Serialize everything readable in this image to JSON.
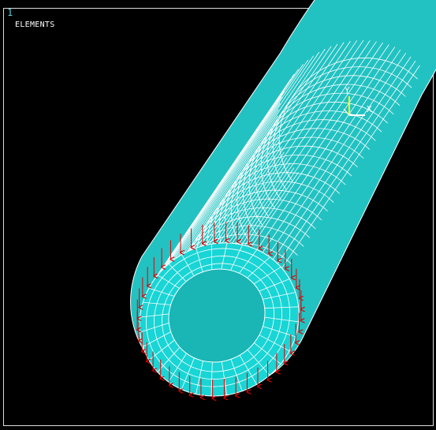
{
  "window": {
    "number": "1",
    "label": "ELEMENTS"
  },
  "triad": {
    "y_label": "Y",
    "x_label": "X"
  },
  "colors": {
    "background": "#000000",
    "mesh_fill": "#20c6c6",
    "mesh_lines": "#ffffff",
    "load_arrows": "#e00000",
    "frame": "#dcdcdc",
    "window_number": "#4fd3e0"
  },
  "model": {
    "type": "hollow-cylinder-mesh",
    "load": "pressure-arrows-on-end-face"
  }
}
